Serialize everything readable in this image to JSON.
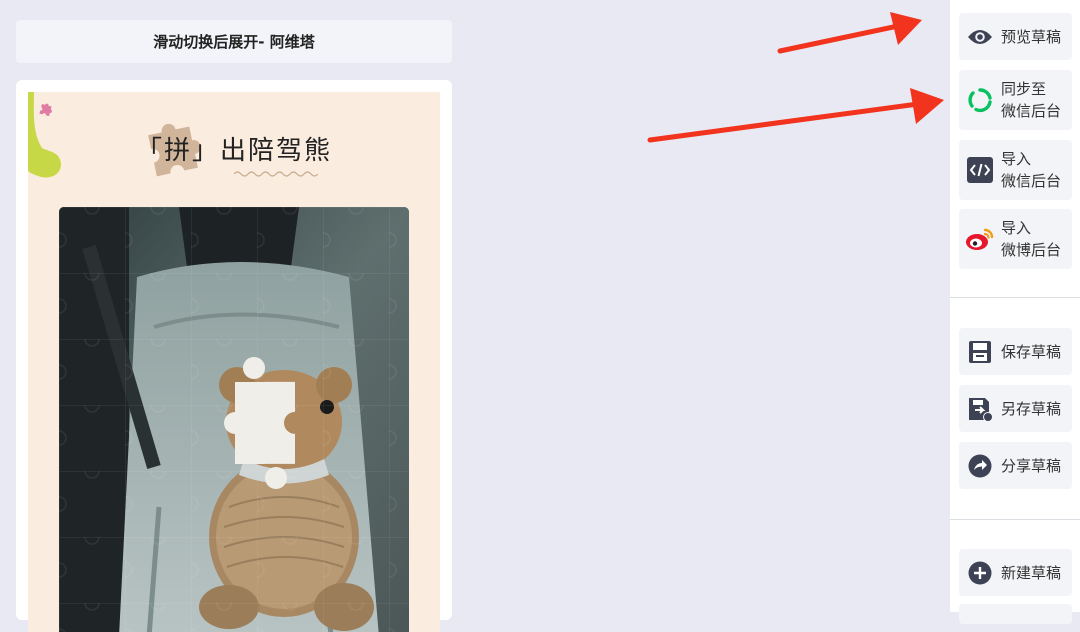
{
  "editor": {
    "title": "滑动切换后展开- 阿维塔"
  },
  "article": {
    "headline": "「拼」出陪驾熊"
  },
  "sidebar": {
    "preview": "预览草稿",
    "sync_line1": "同步至",
    "sync_line2": "微信后台",
    "import_wechat_line1": "导入",
    "import_wechat_line2": "微信后台",
    "import_weibo_line1": "导入",
    "import_weibo_line2": "微博后台",
    "save": "保存草稿",
    "save_as": "另存草稿",
    "share": "分享草稿",
    "new": "新建草稿"
  },
  "colors": {
    "page_bg": "#e8e9f2",
    "article_bg": "#fbece0",
    "arrow": "#f2331d",
    "wechat_green": "#07c160",
    "weibo_red": "#e6162d",
    "icon_dark": "#3d4254"
  },
  "icons": {
    "preview": "eye-icon",
    "sync": "wechat-sync-icon",
    "import_wechat": "code-icon",
    "import_weibo": "weibo-icon",
    "save": "floppy-icon",
    "save_as": "save-as-icon",
    "share": "share-icon",
    "new": "plus-circle-icon"
  }
}
